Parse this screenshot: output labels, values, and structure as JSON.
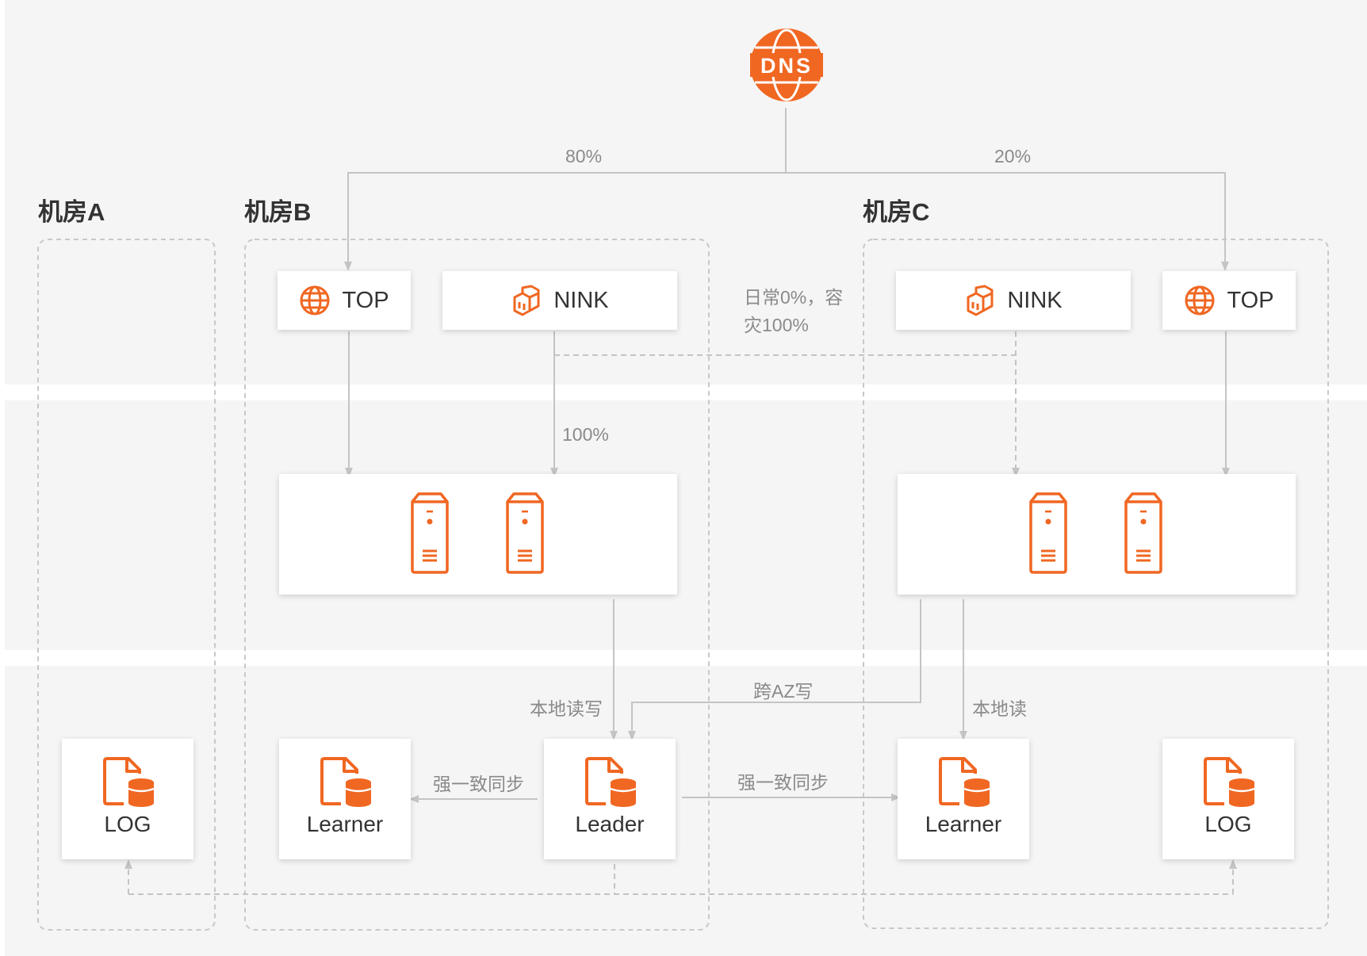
{
  "dns": {
    "label": "DNS"
  },
  "rooms": [
    {
      "id": "a",
      "title": "机房A"
    },
    {
      "id": "b",
      "title": "机房B"
    },
    {
      "id": "c",
      "title": "机房C"
    }
  ],
  "services": {
    "b_top": "TOP",
    "b_nink": "NINK",
    "c_nink": "NINK",
    "c_top": "TOP"
  },
  "nodes": {
    "a_log": "LOG",
    "b_learner": "Learner",
    "b_leader": "Leader",
    "c_learner": "Learner",
    "c_log": "LOG"
  },
  "edge_labels": {
    "dns_left": "80%",
    "dns_right": "20%",
    "disaster": "日常0%，容灾100%",
    "nink_b": "100%",
    "local_rw": "本地读写",
    "cross_az": "跨AZ写",
    "local_read": "本地读",
    "sync_left": "强一致同步",
    "sync_right": "强一致同步"
  },
  "colors": {
    "accent": "#f06722",
    "band": "#f5f5f5",
    "line": "#c4c4c4",
    "dash_border": "#c8c8c8",
    "text": "#333333",
    "annotation": "#8a8a8a"
  },
  "icons": {
    "dns": "dns-globe-icon",
    "top": "globe-icon",
    "nink": "nink-blocks-icon",
    "server": "server-tower-icon",
    "log": "document-database-icon"
  }
}
